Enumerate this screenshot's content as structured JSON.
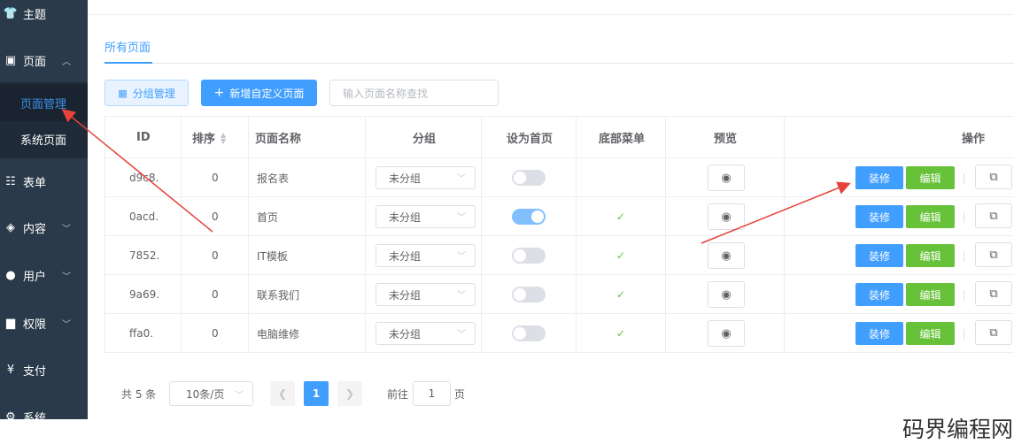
{
  "sidebar": {
    "items": [
      {
        "icon": "shirt-icon",
        "glyph": "👕",
        "label": "主题"
      },
      {
        "icon": "pages-icon",
        "glyph": "▣",
        "label": "页面"
      },
      {
        "icon": "form-icon",
        "glyph": "☷",
        "label": "表单"
      },
      {
        "icon": "layers-icon",
        "glyph": "◈",
        "label": "内容"
      },
      {
        "icon": "user-icon",
        "glyph": "●",
        "label": "用户"
      },
      {
        "icon": "lock-icon",
        "glyph": "▆",
        "label": "权限"
      },
      {
        "icon": "yen-icon",
        "glyph": "¥",
        "label": "支付"
      },
      {
        "icon": "gear-icon",
        "glyph": "⚙",
        "label": "系统"
      }
    ],
    "sub_items": [
      {
        "label": "页面管理",
        "active": true
      },
      {
        "label": "系统页面",
        "active": false
      }
    ]
  },
  "main": {
    "tab": "所有页面",
    "toolbar": {
      "group_button": "分组管理",
      "add_button": "新增自定义页面",
      "search_placeholder": "输入页面名称查找"
    },
    "table": {
      "headers": [
        "ID",
        "排序",
        "页面名称",
        "分组",
        "设为首页",
        "底部菜单",
        "预览",
        "操作"
      ],
      "rows": [
        {
          "id": "d9c8.",
          "sort": "0",
          "name": "报名表",
          "group": "未分组",
          "home": false,
          "bottom_menu": false
        },
        {
          "id": "0acd.",
          "sort": "0",
          "name": "首页",
          "group": "未分组",
          "home": true,
          "bottom_menu": true
        },
        {
          "id": "7852.",
          "sort": "0",
          "name": "IT模板",
          "group": "未分组",
          "home": false,
          "bottom_menu": true
        },
        {
          "id": "9a69.",
          "sort": "0",
          "name": "联系我们",
          "group": "未分组",
          "home": false,
          "bottom_menu": true
        },
        {
          "id": "ffa0.",
          "sort": "0",
          "name": "电脑维修",
          "group": "未分组",
          "home": false,
          "bottom_menu": true
        }
      ],
      "decorate_label": "装修",
      "edit_label": "编辑"
    },
    "pagination": {
      "total": "共 5 条",
      "page_size": "10条/页",
      "current": "1",
      "goto_label": "前往",
      "goto_value": "1",
      "page_suffix": "页"
    }
  },
  "watermark": "码界编程网",
  "colors": {
    "sidebar": "#2b3a4a",
    "accent": "#409eff",
    "success": "#67c23a",
    "arrow": "#e8433a"
  }
}
